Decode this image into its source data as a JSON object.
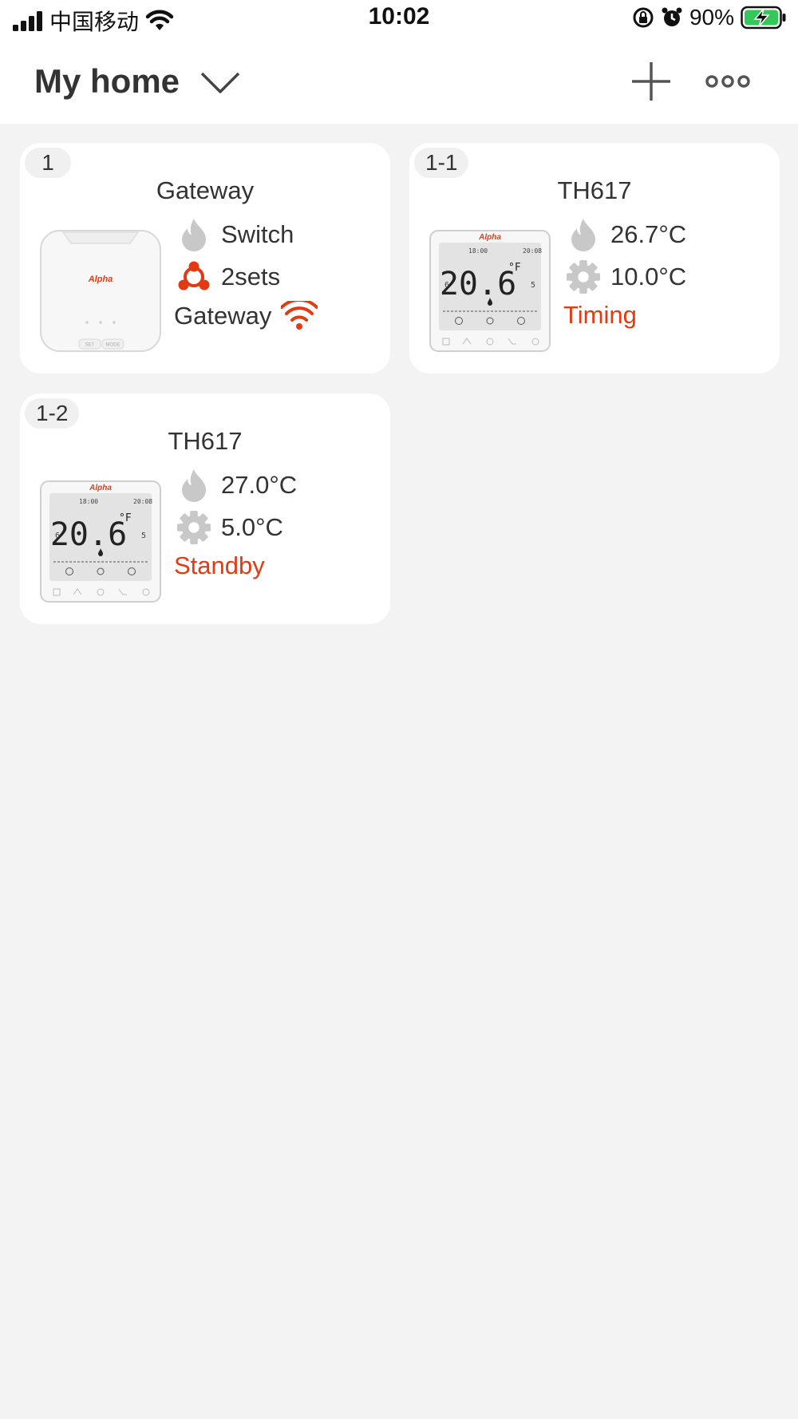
{
  "status_bar": {
    "carrier": "中国移动",
    "time": "10:02",
    "battery_percent": "90%"
  },
  "header": {
    "title": "My home"
  },
  "colors": {
    "accent_red": "#e23b14",
    "icon_gray": "#c8c8c8",
    "card_bg": "#ffffff",
    "page_bg": "#f3f3f3"
  },
  "devices": [
    {
      "badge": "1",
      "title": "Gateway",
      "image_brand": "Alpha",
      "image_buttons": [
        "SET",
        "MODE"
      ],
      "rows": [
        {
          "icon": "flame-icon",
          "text": "Switch"
        },
        {
          "icon": "group-icon",
          "text": "2sets"
        }
      ],
      "status": "Gateway",
      "status_icon": "wifi-icon"
    },
    {
      "badge": "1-1",
      "title": "TH617",
      "image_brand": "Alpha",
      "screen": {
        "temp": "20.6",
        "unit": "°F",
        "time_left": "18:00",
        "time_right": "20:08",
        "left_num": "6",
        "right_num": "5"
      },
      "current_temp": "26.7°C",
      "set_temp": "10.0°C",
      "status": "Timing"
    },
    {
      "badge": "1-2",
      "title": "TH617",
      "image_brand": "Alpha",
      "screen": {
        "temp": "20.6",
        "unit": "°F",
        "time_left": "18:00",
        "time_right": "20:08",
        "left_num": "6",
        "right_num": "5"
      },
      "current_temp": "27.0°C",
      "set_temp": "5.0°C",
      "status": "Standby"
    }
  ]
}
